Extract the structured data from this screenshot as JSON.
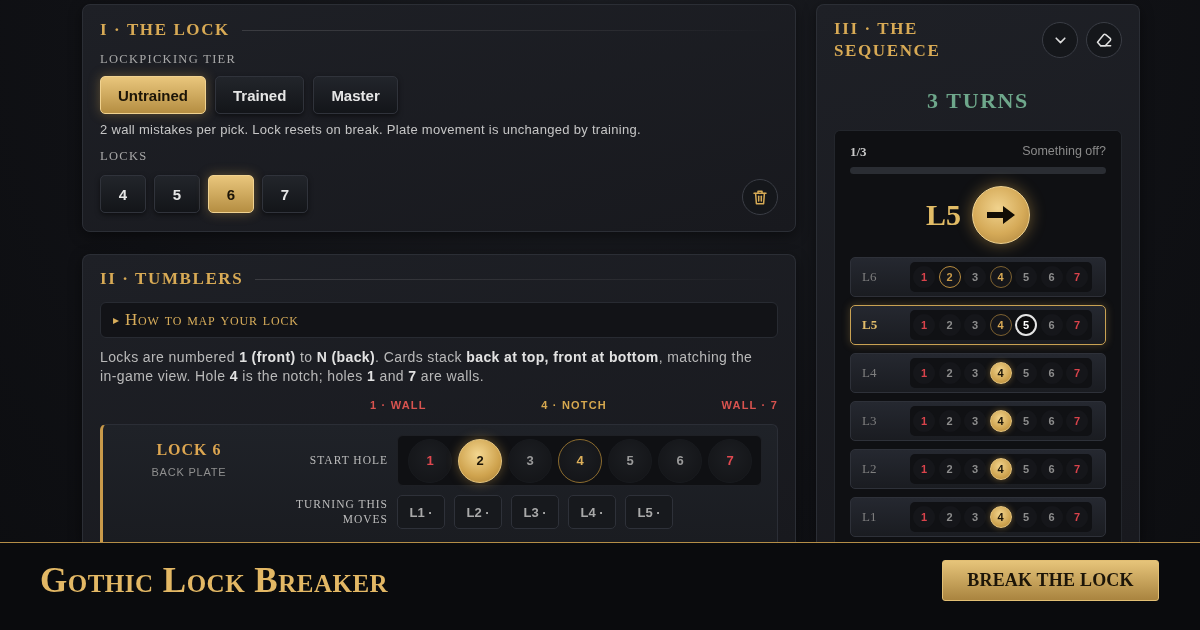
{
  "lock_panel": {
    "title": "I · THE LOCK",
    "tier_label": "LOCKPICKING TIER",
    "tiers": [
      {
        "label": "Untrained",
        "selected": true
      },
      {
        "label": "Trained",
        "selected": false
      },
      {
        "label": "Master",
        "selected": false
      }
    ],
    "tier_note": "2 wall mistakes per pick. Lock resets on break. Plate movement is unchanged by training.",
    "locks_label": "LOCKS",
    "lock_counts": [
      {
        "label": "4",
        "selected": false
      },
      {
        "label": "5",
        "selected": false
      },
      {
        "label": "6",
        "selected": true
      },
      {
        "label": "7",
        "selected": false
      }
    ]
  },
  "tumblers_panel": {
    "title": "II · TUMBLERS",
    "disclosure": {
      "marker": "▸",
      "label": "How to map your lock"
    },
    "intro": "Locks are numbered **1 (front)** to **N (back)**. Cards stack **back at top, front at bottom**, matching the in-game view. Hole **4** is the notch; holes **1** and **7** are walls.",
    "legend": [
      {
        "label": "1 · WALL",
        "kind": "wall"
      },
      {
        "label": "4 · NOTCH",
        "kind": "notch"
      },
      {
        "label": "WALL · 7",
        "kind": "wall"
      }
    ],
    "lock_card": {
      "title": "LOCK 6",
      "subtitle": "BACK PLATE",
      "start_label": "START HOLE",
      "start_holes": [
        {
          "label": "1",
          "kind": "wall",
          "selected": false
        },
        {
          "label": "2",
          "kind": "hole",
          "selected": true
        },
        {
          "label": "3",
          "kind": "hole",
          "selected": false
        },
        {
          "label": "4",
          "kind": "notch",
          "selected": false
        },
        {
          "label": "5",
          "kind": "hole",
          "selected": false
        },
        {
          "label": "6",
          "kind": "hole",
          "selected": false
        },
        {
          "label": "7",
          "kind": "wall",
          "selected": false
        }
      ],
      "moves_label": "TURNING THIS MOVES",
      "moves": [
        "L1 ·",
        "L2 ·",
        "L3 ·",
        "L4 ·",
        "L5 ·"
      ]
    }
  },
  "sequence_panel": {
    "title": "III · THE SEQUENCE",
    "turns": "3 TURNS",
    "step": "1/3",
    "help_link": "Something off?",
    "progress": {
      "level": 0
    },
    "current_move": {
      "lock": "L5"
    },
    "locks": [
      {
        "label": "L6",
        "selected": false,
        "holes": [
          {
            "label": "1",
            "kind": "wall",
            "marked": false,
            "target": false,
            "set": false
          },
          {
            "label": "2",
            "kind": "hole",
            "marked": true,
            "target": false,
            "set": false
          },
          {
            "label": "3",
            "kind": "hole",
            "marked": false,
            "target": false,
            "set": false
          },
          {
            "label": "4",
            "kind": "notch",
            "marked": false,
            "target": false,
            "set": false
          },
          {
            "label": "5",
            "kind": "hole",
            "marked": false,
            "target": false,
            "set": false
          },
          {
            "label": "6",
            "kind": "hole",
            "marked": false,
            "target": false,
            "set": false
          },
          {
            "label": "7",
            "kind": "wall",
            "marked": false,
            "target": false,
            "set": false
          }
        ]
      },
      {
        "label": "L5",
        "selected": true,
        "holes": [
          {
            "label": "1",
            "kind": "wall",
            "marked": false,
            "target": false,
            "set": false
          },
          {
            "label": "2",
            "kind": "hole",
            "marked": false,
            "target": false,
            "set": false
          },
          {
            "label": "3",
            "kind": "hole",
            "marked": false,
            "target": false,
            "set": false
          },
          {
            "label": "4",
            "kind": "notch",
            "marked": false,
            "target": false,
            "set": false
          },
          {
            "label": "5",
            "kind": "hole",
            "marked": false,
            "target": true,
            "set": false
          },
          {
            "label": "6",
            "kind": "hole",
            "marked": false,
            "target": false,
            "set": false
          },
          {
            "label": "7",
            "kind": "wall",
            "marked": false,
            "target": false,
            "set": false
          }
        ]
      },
      {
        "label": "L4",
        "selected": false,
        "holes": [
          {
            "label": "1",
            "kind": "wall",
            "marked": false,
            "target": false,
            "set": false
          },
          {
            "label": "2",
            "kind": "hole",
            "marked": false,
            "target": false,
            "set": false
          },
          {
            "label": "3",
            "kind": "hole",
            "marked": false,
            "target": false,
            "set": false
          },
          {
            "label": "4",
            "kind": "notch",
            "marked": false,
            "target": false,
            "set": true
          },
          {
            "label": "5",
            "kind": "hole",
            "marked": false,
            "target": false,
            "set": false
          },
          {
            "label": "6",
            "kind": "hole",
            "marked": false,
            "target": false,
            "set": false
          },
          {
            "label": "7",
            "kind": "wall",
            "marked": false,
            "target": false,
            "set": false
          }
        ]
      },
      {
        "label": "L3",
        "selected": false,
        "holes": [
          {
            "label": "1",
            "kind": "wall",
            "marked": false,
            "target": false,
            "set": false
          },
          {
            "label": "2",
            "kind": "hole",
            "marked": false,
            "target": false,
            "set": false
          },
          {
            "label": "3",
            "kind": "hole",
            "marked": false,
            "target": false,
            "set": false
          },
          {
            "label": "4",
            "kind": "notch",
            "marked": false,
            "target": false,
            "set": true
          },
          {
            "label": "5",
            "kind": "hole",
            "marked": false,
            "target": false,
            "set": false
          },
          {
            "label": "6",
            "kind": "hole",
            "marked": false,
            "target": false,
            "set": false
          },
          {
            "label": "7",
            "kind": "wall",
            "marked": false,
            "target": false,
            "set": false
          }
        ]
      },
      {
        "label": "L2",
        "selected": false,
        "holes": [
          {
            "label": "1",
            "kind": "wall",
            "marked": false,
            "target": false,
            "set": false
          },
          {
            "label": "2",
            "kind": "hole",
            "marked": false,
            "target": false,
            "set": false
          },
          {
            "label": "3",
            "kind": "hole",
            "marked": false,
            "target": false,
            "set": false
          },
          {
            "label": "4",
            "kind": "notch",
            "marked": false,
            "target": false,
            "set": true
          },
          {
            "label": "5",
            "kind": "hole",
            "marked": false,
            "target": false,
            "set": false
          },
          {
            "label": "6",
            "kind": "hole",
            "marked": false,
            "target": false,
            "set": false
          },
          {
            "label": "7",
            "kind": "wall",
            "marked": false,
            "target": false,
            "set": false
          }
        ]
      },
      {
        "label": "L1",
        "selected": false,
        "holes": [
          {
            "label": "1",
            "kind": "wall",
            "marked": false,
            "target": false,
            "set": false
          },
          {
            "label": "2",
            "kind": "hole",
            "marked": false,
            "target": false,
            "set": false
          },
          {
            "label": "3",
            "kind": "hole",
            "marked": false,
            "target": false,
            "set": false
          },
          {
            "label": "4",
            "kind": "notch",
            "marked": false,
            "target": false,
            "set": true
          },
          {
            "label": "5",
            "kind": "hole",
            "marked": false,
            "target": false,
            "set": false
          },
          {
            "label": "6",
            "kind": "hole",
            "marked": false,
            "target": false,
            "set": false
          },
          {
            "label": "7",
            "kind": "wall",
            "marked": false,
            "target": false,
            "set": false
          }
        ]
      }
    ]
  },
  "footer": {
    "title": "Gothic Lock Breaker",
    "button": "BREAK THE LOCK"
  }
}
